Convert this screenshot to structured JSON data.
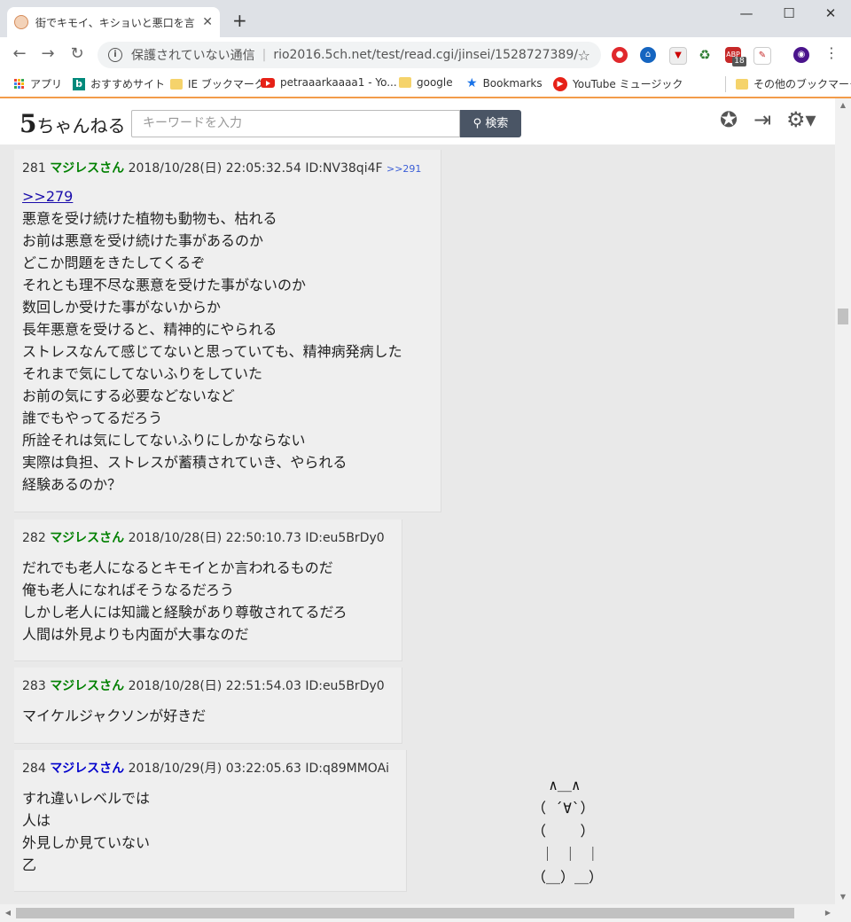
{
  "browser": {
    "tab_title": "街でキモイ、キショいと悪口を言われる",
    "tab_close": "✕",
    "new_tab": "+",
    "win_minimize": "—",
    "win_maximize": "☐",
    "win_close": "✕",
    "security_label": "保護されていない通信",
    "separator": "|",
    "url": "rio2016.5ch.net/test/read.cgi/jinsei/1528727389/",
    "ext_badge": "18"
  },
  "bookmarks": [
    {
      "label": "アプリ",
      "icon": "apps-icon"
    },
    {
      "label": "おすすめサイト",
      "icon": "bing-icon"
    },
    {
      "label": "IE ブックマーク",
      "icon": "folder-icon"
    },
    {
      "label": "petraaarkaaaa1 - Yo...",
      "icon": "youtube-icon"
    },
    {
      "label": "google",
      "icon": "folder-icon"
    },
    {
      "label": "Bookmarks",
      "icon": "star-icon"
    },
    {
      "label": "YouTube ミュージック",
      "icon": "youtube-music-icon"
    },
    {
      "label": "その他のブックマーク",
      "icon": "folder-icon"
    }
  ],
  "site": {
    "logo_num": "5",
    "logo_text": "ちゃんねる",
    "search_placeholder": "キーワードを入力",
    "search_button": "検索"
  },
  "posts": [
    {
      "num": "281",
      "name": "マジレスさん",
      "date": "2018/10/28(日) 22:05:32.54",
      "id": "ID:NV38qi4F",
      "reply": ">>291",
      "anchor": ">>279",
      "lines": [
        "悪意を受け続けた植物も動物も、枯れる",
        "お前は悪意を受け続けた事があるのか",
        "どこか問題をきたしてくるぞ",
        "それとも理不尽な悪意を受けた事がないのか",
        "数回しか受けた事がないからか",
        "長年悪意を受けると、精神的にやられる",
        "ストレスなんて感じてないと思っていても、精神病発病した",
        "それまで気にしてないふりをしていた",
        "お前の気にする必要などないなど",
        "誰でもやってるだろう",
        "所詮それは気にしてないふりにしかならない",
        "実際は負担、ストレスが蓄積されていき、やられる",
        "経験あるのか？"
      ]
    },
    {
      "num": "282",
      "name": "マジレスさん",
      "date": "2018/10/28(日) 22:50:10.73",
      "id": "ID:eu5BrDy0",
      "lines": [
        "だれでも老人になるとキモイとか言われるものだ",
        "俺も老人になればそうなるだろう",
        "しかし老人には知識と経験があり尊敬されてるだろ",
        "人間は外見よりも内面が大事なのだ"
      ]
    },
    {
      "num": "283",
      "name": "マジレスさん",
      "date": "2018/10/28(日) 22:51:54.03",
      "id": "ID:eu5BrDy0",
      "lines": [
        "マイケルジャクソンが好きだ"
      ]
    },
    {
      "num": "284",
      "name": "マジレスさん",
      "date": "2018/10/29(月) 03:22:05.63",
      "id": "ID:q89MMOAi",
      "lines": [
        "すれ違いレベルでは",
        "人は",
        "外見しか見ていない",
        "乙"
      ]
    }
  ],
  "ascii_art": "  ∧＿∧\n（ ´∀`）\n（    ）\n ｜ ｜ ｜\n（＿）＿）"
}
